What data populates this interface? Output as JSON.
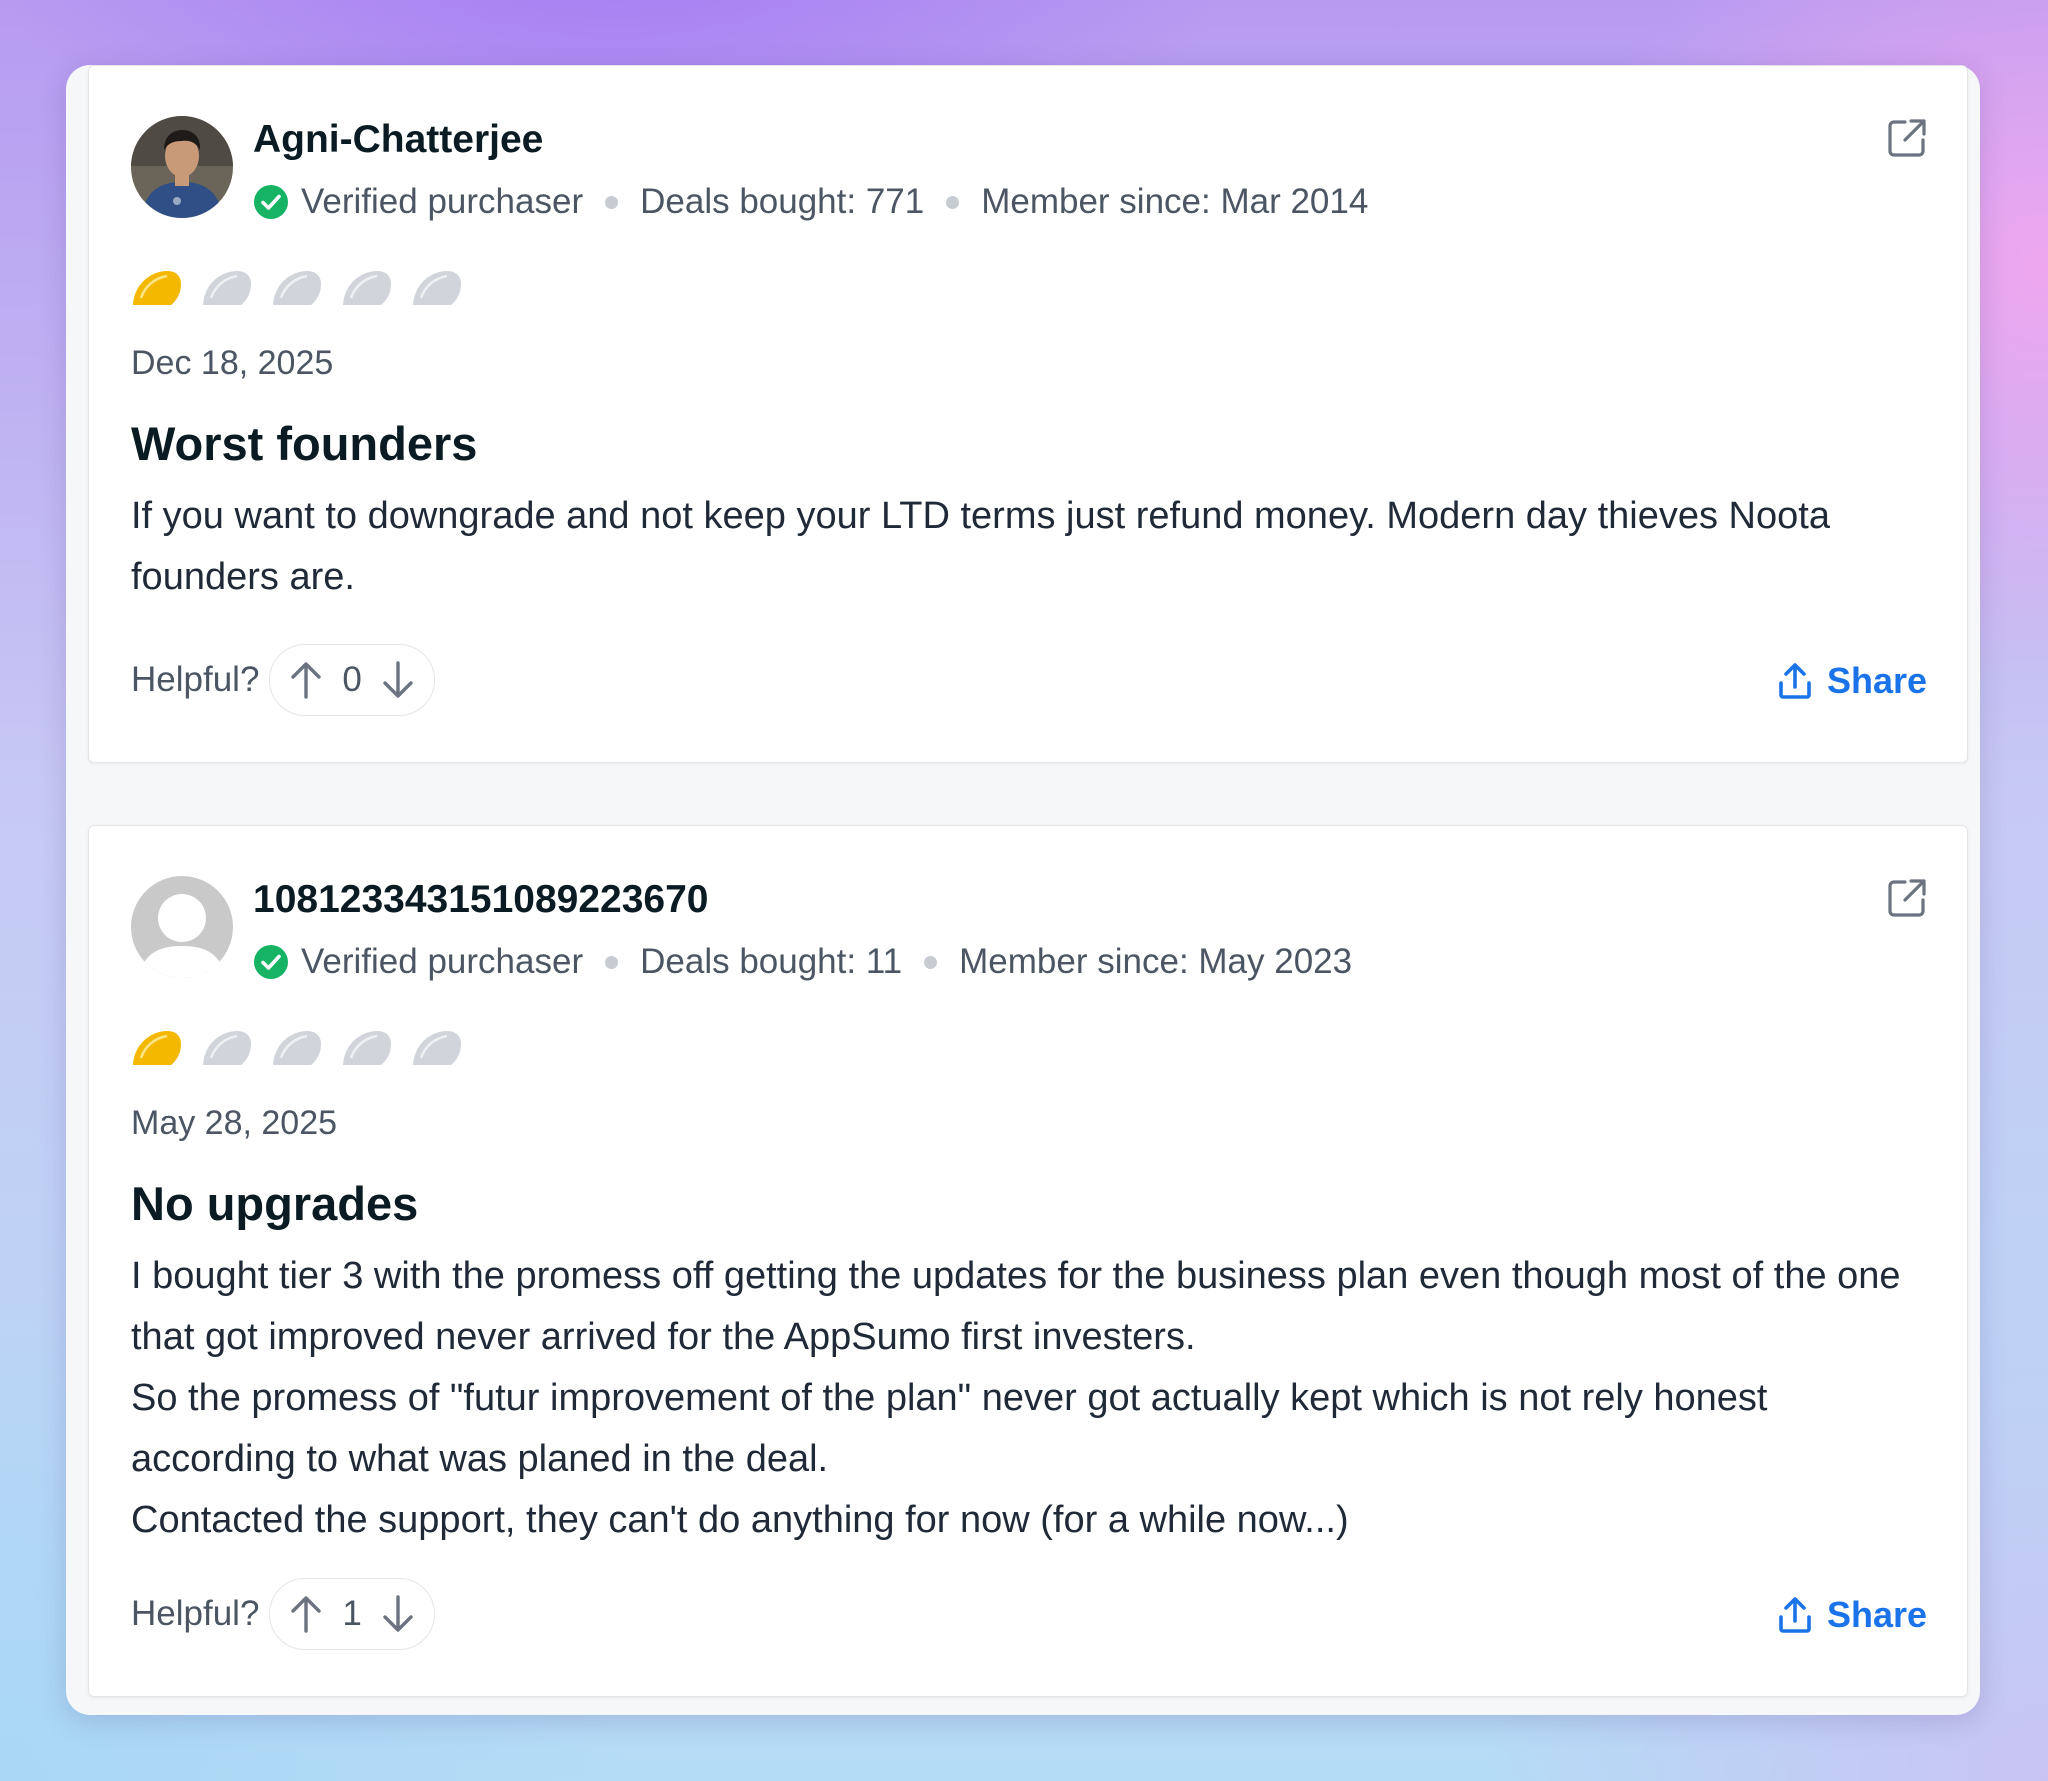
{
  "reviews": [
    {
      "username": "Agni-Chatterjee",
      "avatar": "user-photo",
      "verified_label": "Verified purchaser",
      "deals_bought": "Deals bought: 771",
      "member_since": "Member since: Mar 2014",
      "rating": 1,
      "rating_max": 5,
      "date": "Dec 18, 2025",
      "title": "Worst founders",
      "body": [
        "If you want to downgrade and not keep your LTD terms just refund money. Modern day thieves Noota founders are."
      ],
      "helpful_label": "Helpful?",
      "votes": "0",
      "share_label": "Share"
    },
    {
      "username": "108123343151089223670",
      "avatar": "default-avatar",
      "verified_label": "Verified purchaser",
      "deals_bought": "Deals bought: 11",
      "member_since": "Member since: May 2023",
      "rating": 1,
      "rating_max": 5,
      "date": "May 28, 2025",
      "title": "No upgrades",
      "body": [
        "I bought tier 3 with the promess off getting the updates for the business plan even though most of the one that got improved never arrived for the AppSumo first investers.",
        "So the promess of \"futur improvement of the plan\" never got actually kept which is not rely honest according to what was planed in the deal.",
        "Contacted the support, they can't do anything for now (for a while now...)"
      ],
      "helpful_label": "Helpful?",
      "votes": "1",
      "share_label": "Share"
    }
  ],
  "colors": {
    "star_filled": "#f5b800",
    "star_empty": "#d1d5db",
    "verified": "#16b364",
    "share": "#1a73e8"
  },
  "icons": [
    "external-link-icon",
    "verified-check-icon",
    "taco-star-icon",
    "arrow-up-icon",
    "arrow-down-icon",
    "share-icon"
  ]
}
